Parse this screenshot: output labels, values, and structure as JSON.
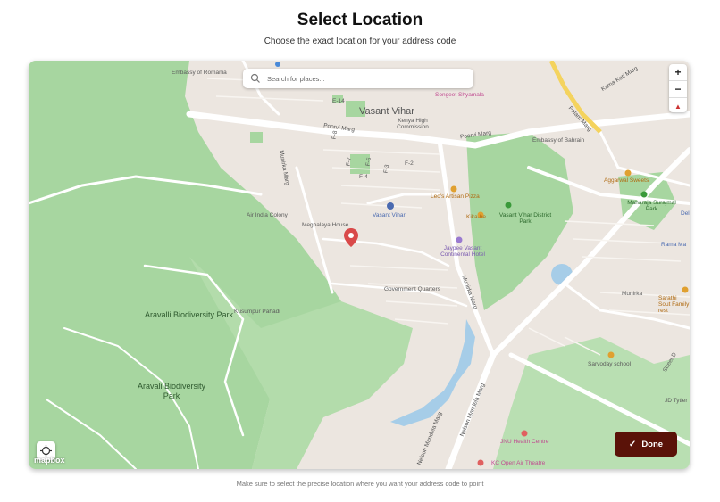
{
  "page": {
    "title": "Select Location",
    "subtitle": "Choose the exact location for your address code",
    "footer_note": "Make sure to select the precise location where you want your address code to point"
  },
  "search": {
    "placeholder": "Search for places..."
  },
  "map_controls": {
    "zoom_in": "+",
    "zoom_out": "−",
    "compass": "▲"
  },
  "done_button": {
    "label": "Done",
    "color": "#5a1208"
  },
  "attribution": "mapbox",
  "map_labels": {
    "aravalli_park_1": "Aravalli Biodiversity Park",
    "aravalli_park_2": "Aravali Biodiversity Park",
    "vasant_vihar": "Vasant Vihar",
    "poorvi_marg_1": "Poorvi Marg",
    "poorvi_marg_2": "Poorvi Marg",
    "munirka_marg_1": "Munirka Marg",
    "munirka_marg_2": "Munirka Marg",
    "palam_marg": "Palam Marg",
    "kama_koti_marg": "Kama Koti Marg",
    "nelson_mandela_marg_1": "Nelson Mandela Marg",
    "nelson_mandela_marg_2": "Nelson Mandela Marg",
    "embassy_romania": "Embassy of Romania",
    "embassy_bahrain": "Embassy of Bahrain",
    "songeet": "Songeet Shyamala",
    "kenya": "Kenya High Commission",
    "e14": "E-14",
    "f8": "F-8",
    "f7": "F-7",
    "f5": "F-5",
    "f3": "F-3",
    "f2": "F-2",
    "f4": "F-4",
    "air_india": "Air India Colony",
    "meghalaya": "Meghalaya House",
    "vasant_vihar_station": "Vasant Vihar",
    "leos": "Leo's Artisan Pizza",
    "kikabe": "Kika-be",
    "vv_district_park": "Vasant Vihar District Park",
    "jaypee": "Jaypee Vasant Continental Hotel",
    "govt_quarters": "Government Quarters",
    "kusumpur": "Kusumpur Pahadi",
    "aggarwal": "Aggarwal Sweets",
    "maharaja": "Maharaja Surajmal Park",
    "munirka": "Munirka",
    "sarvoday": "Sarvoday school",
    "jnu_health": "JNU Health Centre",
    "kc_theatre": "KC Open Air Theatre",
    "jd_tytler": "JD Tytler",
    "street_d": "Street D",
    "sarathi": "Sarathi Sout Family rest",
    "rama": "Rama Ma",
    "del": "Del"
  }
}
